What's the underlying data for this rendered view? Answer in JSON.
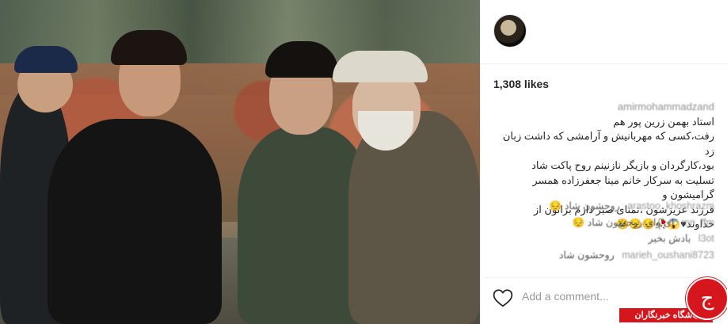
{
  "post": {
    "likes": "1,308 likes",
    "caption_user": "amirmohammadzand",
    "caption_lines": [
      "استاد بهمن زرین پور هم",
      "رفت،کسی که مهربانیش و آرامشی که داشت زبان زد",
      "بود،کارگردان و بازیگر نازنینم روح پاکت شاد",
      "تسلیت به سرکار خانم مینا جعفرزاده همسر گرامیشون و",
      "فرزند عزیزشون ،تمنای صبر دارم براتون از",
      "خداوند♥😱🥀😔😔😢"
    ]
  },
  "comments": [
    {
      "user": "arastoo_khoshrazm",
      "text": "روحشون شاد 😔"
    },
    {
      "user": "mn_ffm",
      "text": "ای وای روحشون شاد 😔"
    },
    {
      "user": "l3ot",
      "text": "یادش بخیر"
    },
    {
      "user": "marieh_oushani8723",
      "text": "روحشون شاد"
    }
  ],
  "compose": {
    "placeholder": "Add a comment..."
  },
  "watermark": {
    "text": "باشگاه خبرنگاران"
  },
  "colors": {
    "watermark_red": "#d5161d",
    "likes_text": "#262626",
    "muted": "#999999"
  },
  "icons": {
    "like": "heart-outline-icon",
    "watermark_logo": "yjc-logo-icon"
  }
}
